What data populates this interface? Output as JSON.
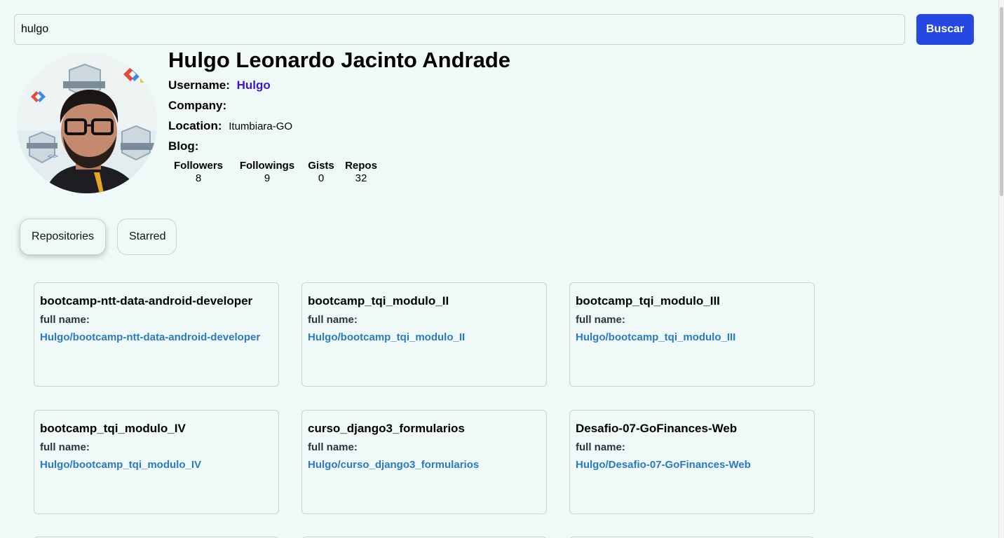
{
  "search": {
    "value": "hulgo",
    "button_label": "Buscar"
  },
  "profile": {
    "name": "Hulgo Leonardo Jacinto Andrade",
    "username_label": "Username:",
    "username": "Hulgo",
    "company_label": "Company:",
    "company": "",
    "location_label": "Location:",
    "location": "Itumbiara-GO",
    "blog_label": "Blog:",
    "blog": "",
    "stats": [
      {
        "label": "Followers",
        "value": "8"
      },
      {
        "label": "Followings",
        "value": "9"
      },
      {
        "label": "Gists",
        "value": "0"
      },
      {
        "label": "Repos",
        "value": "32"
      }
    ]
  },
  "tabs": [
    {
      "label": "Repositories",
      "active": true
    },
    {
      "label": "Starred",
      "active": false
    }
  ],
  "repos": [
    {
      "name": "bootcamp-ntt-data-android-developer",
      "full_name_label": "full name:",
      "full_name": "Hulgo/bootcamp-ntt-data-android-developer"
    },
    {
      "name": "bootcamp_tqi_modulo_II",
      "full_name_label": "full name:",
      "full_name": "Hulgo/bootcamp_tqi_modulo_II"
    },
    {
      "name": "bootcamp_tqi_modulo_III",
      "full_name_label": "full name:",
      "full_name": "Hulgo/bootcamp_tqi_modulo_III"
    },
    {
      "name": "bootcamp_tqi_modulo_IV",
      "full_name_label": "full name:",
      "full_name": "Hulgo/bootcamp_tqi_modulo_IV"
    },
    {
      "name": "curso_django3_formularios",
      "full_name_label": "full name:",
      "full_name": "Hulgo/curso_django3_formularios"
    },
    {
      "name": "Desafio-07-GoFinances-Web",
      "full_name_label": "full name:",
      "full_name": "Hulgo/Desafio-07-GoFinances-Web"
    }
  ],
  "colors": {
    "background": "#effaf8",
    "accent": "#2648e0",
    "username": "#3f14d8",
    "repo_link": "#2a79c4"
  }
}
